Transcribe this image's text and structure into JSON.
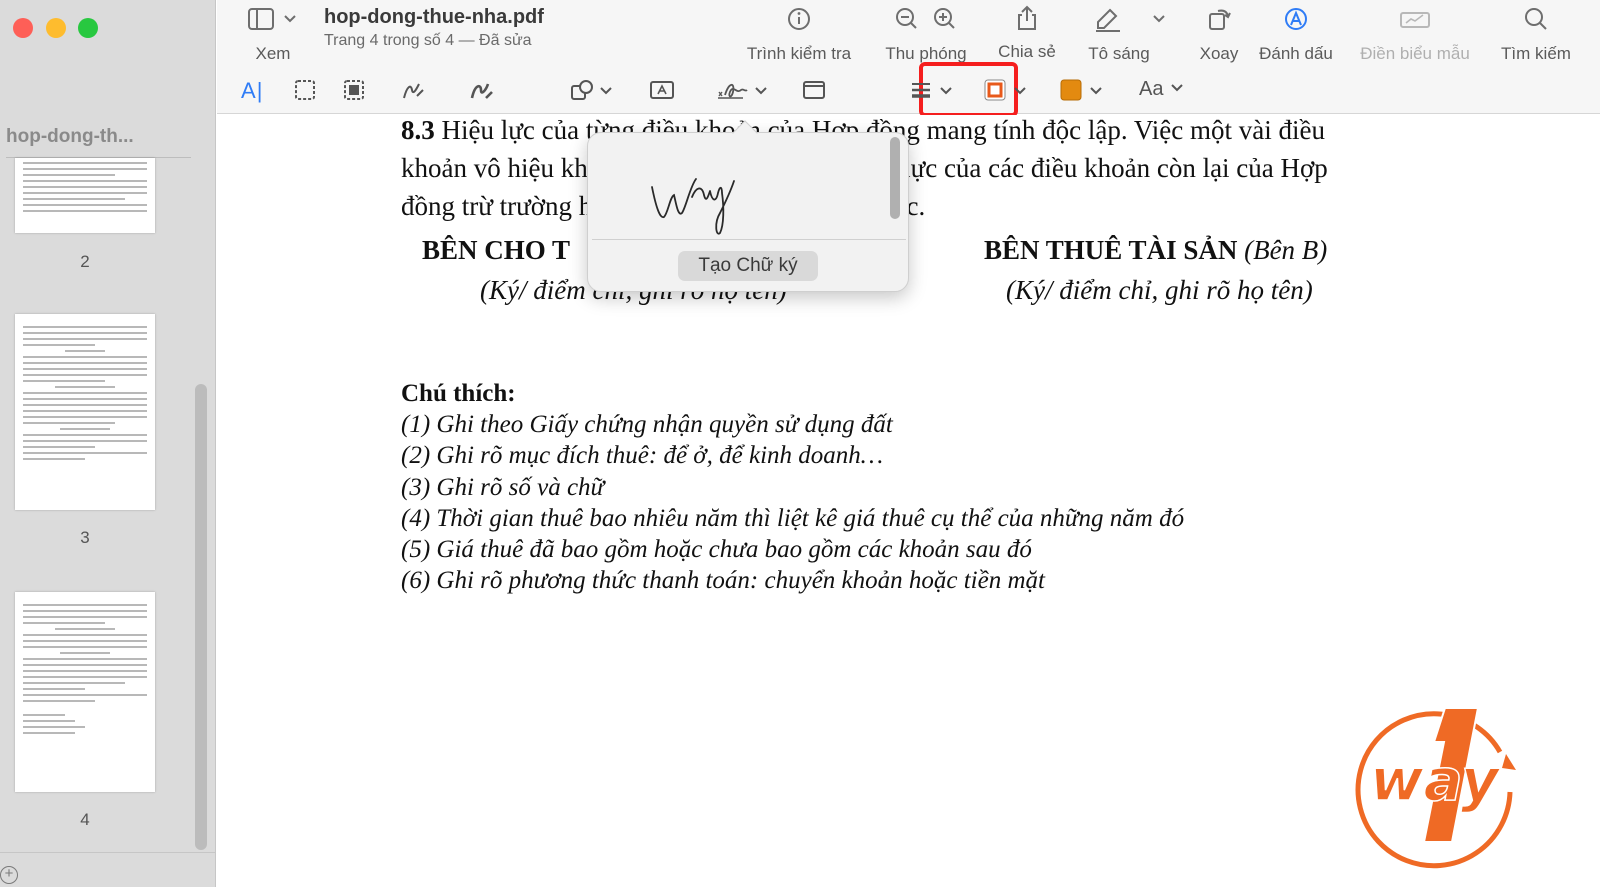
{
  "window": {
    "file_name": "hop-dong-thue-nha.pdf",
    "subtitle": "Trang 4 trong số 4 — Đã sửa"
  },
  "toolbar": {
    "view_label": "Xem",
    "inspector_label": "Trình kiểm tra",
    "zoom_label": "Thu phóng",
    "share_label": "Chia sẻ",
    "highlight_label": "Tô sáng",
    "rotate_label": "Xoay",
    "markup_label": "Đánh dấu",
    "fill_form_label": "Điền biểu mẫu",
    "search_label": "Tìm kiếm",
    "text_tool": "A",
    "font_tool": "Aa",
    "border_color": "#e8591a",
    "fill_color": "#e38a10"
  },
  "sidebar": {
    "doc_title": "hop-dong-th...",
    "pages": [
      {
        "number": "2"
      },
      {
        "number": "3"
      },
      {
        "number": "4"
      }
    ]
  },
  "document": {
    "para_lines": [
      "8.3 Hiệu lực của từng điều khoản của Hợp đồng mang tính độc lập. Việc một vài điều",
      "khoản vô hiệu không làm ảnh hưởng đến hiệu lực của các điều khoản còn lại của Hợp",
      "đồng trừ trường hợp pháp luật có quy định khác."
    ],
    "party_a_title": "BÊN CHO T",
    "party_a_note": "(Ký/ điểm chỉ, ghi rõ họ tên)",
    "party_b_title": "BÊN THUÊ TÀI SẢN",
    "party_b_role": "(Bên B)",
    "party_b_note": "(Ký/ điểm chỉ, ghi rõ họ tên)",
    "notes_title": "Chú thích:",
    "notes": [
      "(1) Ghi theo Giấy chứng nhận quyền sử dụng đất",
      "(2) Ghi rõ mục đích thuê: để ở, để kinh doanh…",
      "(3) Ghi rõ số và chữ",
      "(4) Thời gian thuê bao nhiêu năm thì liệt kê giá thuê cụ thể của những năm đó",
      "(5) Giá thuê đã bao gồm hoặc chưa bao gồm các khoản sau đó",
      "(6) Ghi rõ phương thức thanh toán: chuyển khoản hoặc tiền mặt"
    ]
  },
  "signature_popover": {
    "create_button": "Tạo Chữ ký"
  },
  "logo": {
    "text": "way",
    "digit": "1",
    "color": "#ef6a25"
  }
}
